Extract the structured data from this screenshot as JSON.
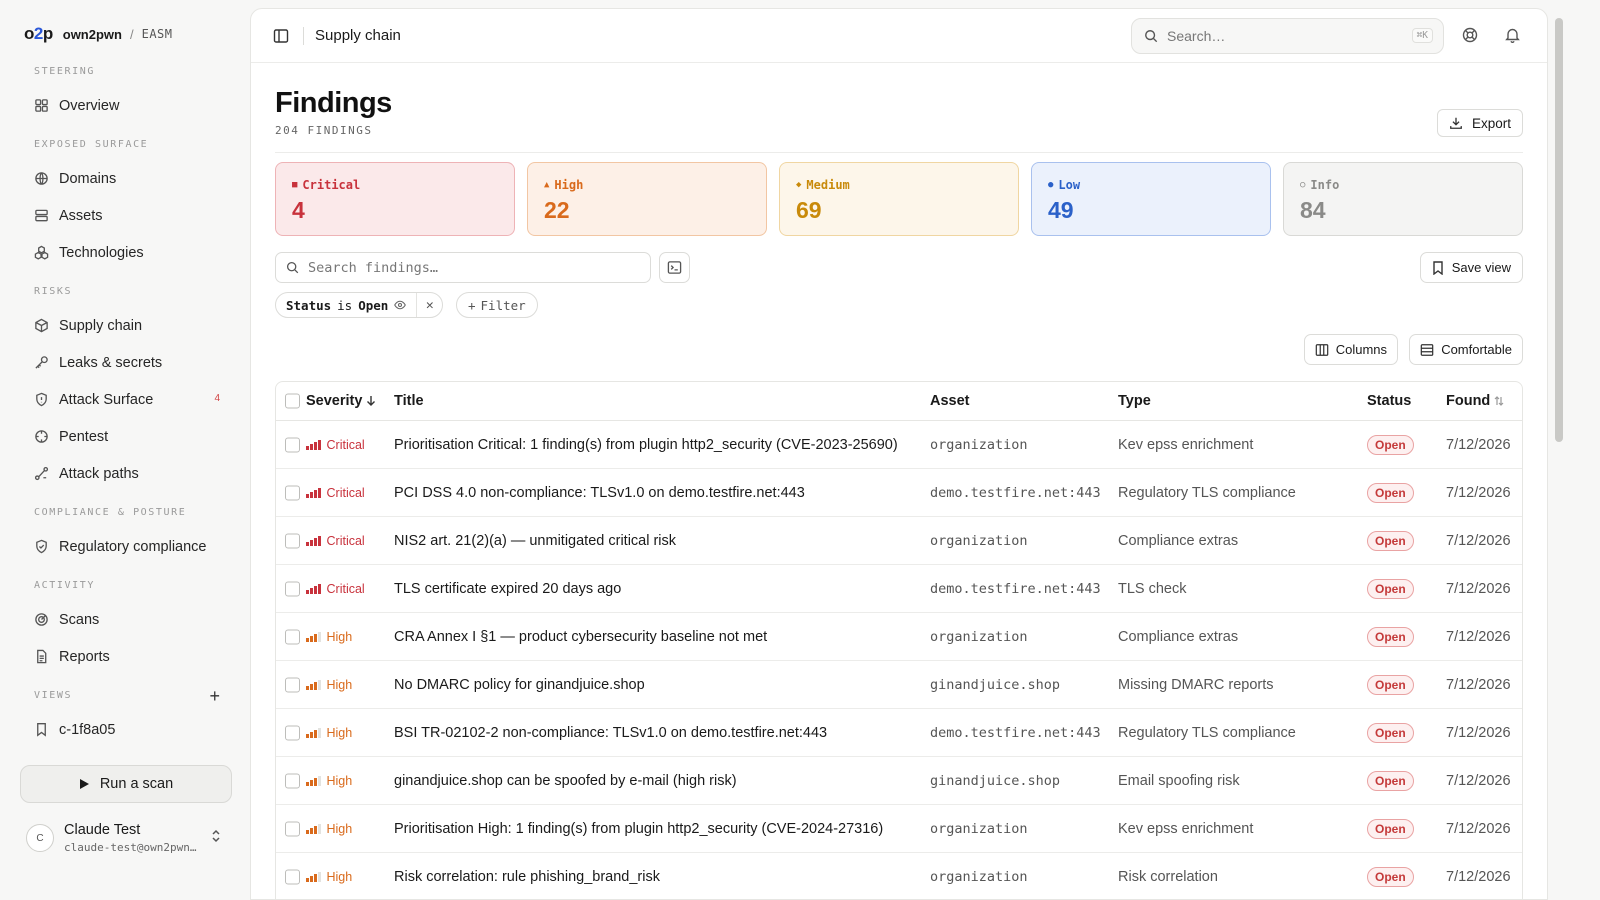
{
  "brand": {
    "logo_a": "o",
    "logo_b": "2",
    "logo_c": "p",
    "org": "own2pwn",
    "separator": "/",
    "product": "EASM"
  },
  "sidebar": {
    "sections": {
      "steering": "STEERING",
      "exposed": "EXPOSED SURFACE",
      "risks": "RISKS",
      "compliance": "COMPLIANCE & POSTURE",
      "activity": "ACTIVITY",
      "views": "VIEWS"
    },
    "items": {
      "overview": "Overview",
      "domains": "Domains",
      "assets": "Assets",
      "technologies": "Technologies",
      "supply_chain": "Supply chain",
      "leaks": "Leaks & secrets",
      "attack_surface": "Attack Surface",
      "attack_surface_badge": "4",
      "pentest": "Pentest",
      "attack_paths": "Attack paths",
      "regulatory": "Regulatory compliance",
      "scans": "Scans",
      "reports": "Reports",
      "view_1": "c-1f8a05"
    },
    "run_scan": "Run a scan",
    "user": {
      "initial": "C",
      "name": "Claude Test",
      "email": "claude-test@own2pwn…"
    }
  },
  "topbar": {
    "breadcrumb": "Supply chain",
    "search_placeholder": "Search…",
    "search_shortcut": "⌘K"
  },
  "page": {
    "title": "Findings",
    "count": "204 FINDINGS",
    "export": "Export"
  },
  "severity_cards": {
    "critical": {
      "label": "Critical",
      "value": "4",
      "glyph": "■"
    },
    "high": {
      "label": "High",
      "value": "22",
      "glyph": "▲"
    },
    "medium": {
      "label": "Medium",
      "value": "69",
      "glyph": "◆"
    },
    "low": {
      "label": "Low",
      "value": "49",
      "glyph": "●"
    },
    "info": {
      "label": "Info",
      "value": "84",
      "glyph": "○"
    }
  },
  "filters": {
    "search_placeholder": "Search findings…",
    "save_view": "Save view",
    "chip": {
      "field": "Status",
      "op": "is",
      "value": "Open"
    },
    "add_filter": "Filter",
    "columns": "Columns",
    "density": "Comfortable"
  },
  "table": {
    "headers": {
      "severity": "Severity",
      "title": "Title",
      "asset": "Asset",
      "type": "Type",
      "status": "Status",
      "found": "Found"
    },
    "rows": [
      {
        "severity": "Critical",
        "title": "Prioritisation Critical: 1 finding(s) from plugin http2_security (CVE-2023-25690)",
        "asset": "organization",
        "type": "Kev epss enrichment",
        "status": "Open",
        "found": "7/12/2026"
      },
      {
        "severity": "Critical",
        "title": "PCI DSS 4.0 non-compliance: TLSv1.0 on demo.testfire.net:443",
        "asset": "demo.testfire.net:443",
        "type": "Regulatory TLS compliance",
        "status": "Open",
        "found": "7/12/2026"
      },
      {
        "severity": "Critical",
        "title": "NIS2 art. 21(2)(a) — unmitigated critical risk",
        "asset": "organization",
        "type": "Compliance extras",
        "status": "Open",
        "found": "7/12/2026"
      },
      {
        "severity": "Critical",
        "title": "TLS certificate expired 20 days ago",
        "asset": "demo.testfire.net:443",
        "type": "TLS check",
        "status": "Open",
        "found": "7/12/2026"
      },
      {
        "severity": "High",
        "title": "CRA Annex I §1 — product cybersecurity baseline not met",
        "asset": "organization",
        "type": "Compliance extras",
        "status": "Open",
        "found": "7/12/2026"
      },
      {
        "severity": "High",
        "title": "No DMARC policy for ginandjuice.shop",
        "asset": "ginandjuice.shop",
        "type": "Missing DMARC reports",
        "status": "Open",
        "found": "7/12/2026"
      },
      {
        "severity": "High",
        "title": "BSI TR-02102-2 non-compliance: TLSv1.0 on demo.testfire.net:443",
        "asset": "demo.testfire.net:443",
        "type": "Regulatory TLS compliance",
        "status": "Open",
        "found": "7/12/2026"
      },
      {
        "severity": "High",
        "title": "ginandjuice.shop can be spoofed by e-mail (high risk)",
        "asset": "ginandjuice.shop",
        "type": "Email spoofing risk",
        "status": "Open",
        "found": "7/12/2026"
      },
      {
        "severity": "High",
        "title": "Prioritisation High: 1 finding(s) from plugin http2_security (CVE-2024-27316)",
        "asset": "organization",
        "type": "Kev epss enrichment",
        "status": "Open",
        "found": "7/12/2026"
      },
      {
        "severity": "High",
        "title": "Risk correlation: rule phishing_brand_risk",
        "asset": "organization",
        "type": "Risk correlation",
        "status": "Open",
        "found": "7/12/2026"
      }
    ]
  },
  "colors": {
    "critical": "#c8323c",
    "high": "#d96a1c",
    "medium": "#c98a0a",
    "low": "#2b61c9",
    "info": "#8a8a88",
    "accent": "#2a57d8"
  }
}
